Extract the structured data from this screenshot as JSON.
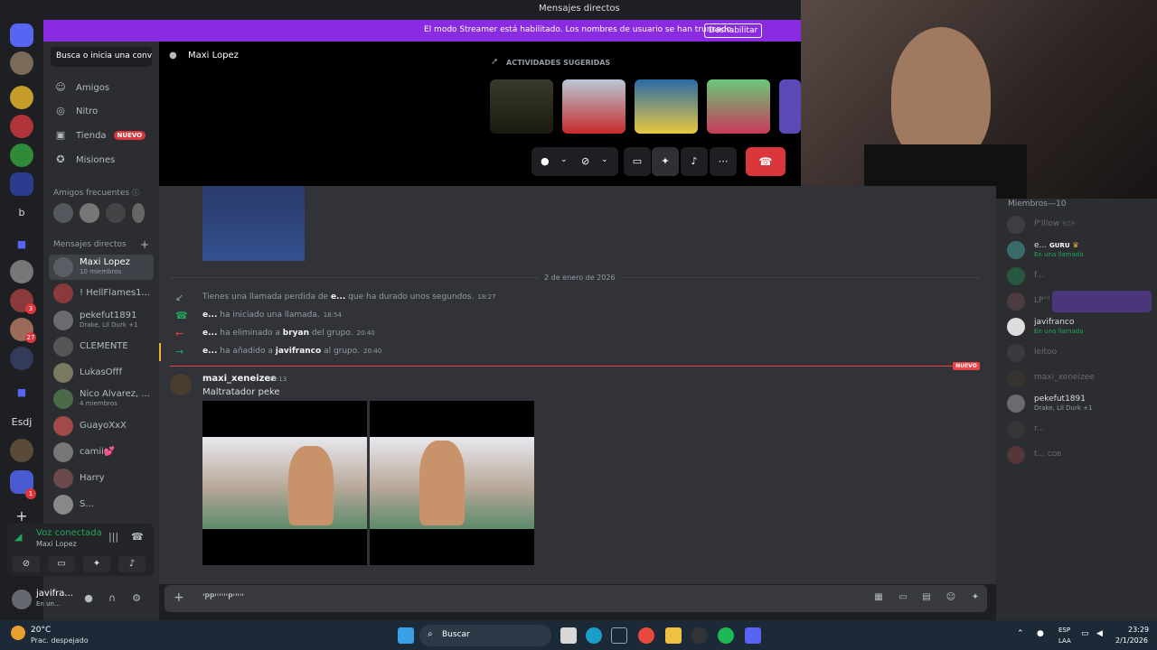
{
  "window": {
    "title": "Mensajes directos"
  },
  "streamer": {
    "message": "El modo Streamer está habilitado. Los nombres de usuario se han truncado.",
    "disable_label": "Deshabilitar"
  },
  "sidebar": {
    "search_label": "Busca o inicia una conv...",
    "nav": [
      {
        "label": "Amigos",
        "icon": "friends-icon"
      },
      {
        "label": "Nitro",
        "icon": "nitro-icon"
      },
      {
        "label": "Tienda",
        "icon": "shop-icon",
        "badge": "NUEVO"
      },
      {
        "label": "Misiones",
        "icon": "quests-icon"
      }
    ],
    "frequent_label": "Amigos frecuentes",
    "dm_label": "Mensajes directos",
    "dms": [
      {
        "name": "Maxi Lopez",
        "sub": "10 miembros"
      },
      {
        "name": "! HellFlames1..."
      },
      {
        "name": "pekefut1891",
        "sub": "Drake, Lil Durk +1"
      },
      {
        "name": "CLEMENTE"
      },
      {
        "name": "LukasOfff"
      },
      {
        "name": "Nico Alvarez, ...",
        "sub": "4 miembros"
      },
      {
        "name": "GuayoXxX"
      },
      {
        "name": "camii💕"
      },
      {
        "name": "Harry"
      },
      {
        "name": "S..."
      }
    ],
    "guild_text": {
      "b": "b",
      "esdj": "Esdj"
    },
    "guild_badges": [
      "3",
      "27",
      "1"
    ]
  },
  "voice": {
    "status": "Voz conectada",
    "channel": "Maxi Lopez"
  },
  "user": {
    "name": "javifra...",
    "status": "En un..."
  },
  "call": {
    "name": "Maxi Lopez",
    "activities_title": "ACTIVIDADES SUGERIDAS"
  },
  "chat": {
    "date": "2 de enero de 2026",
    "system": [
      {
        "pre": "Tienes una llamada perdida de ",
        "bold": "e...",
        "post": " que ha durado unos segundos.",
        "time": "18:27",
        "color": "#949ba4"
      },
      {
        "pre": "",
        "bold": "e...",
        "post": " ha iniciado una llamada.",
        "time": "18:54",
        "color": "#23a55a"
      },
      {
        "pre": "",
        "bold": "e...",
        "mid": " ha eliminado a ",
        "bold2": "bryan",
        "post": " del grupo.",
        "time": "20:40",
        "color": "#f23f43"
      },
      {
        "pre": "",
        "bold": "e...",
        "mid": " ha añadido a ",
        "bold2": "javifranco",
        "post": " al grupo.",
        "time": "20:40",
        "color": "#23a55a"
      }
    ],
    "new_label": "NUEVO",
    "message": {
      "author": "maxi_xeneizee",
      "time": "23:13",
      "text": "Maltratador peke"
    },
    "composer_value": "'PP''''''P'''''"
  },
  "members": {
    "title": "Miembros—10",
    "list": [
      {
        "name": "P'lllow",
        "tag": "RZR",
        "dim": true
      },
      {
        "name": "e...",
        "tag": "GURU",
        "sub": "En una llamada",
        "dim": false
      },
      {
        "name": "f...",
        "dim": true
      },
      {
        "name": "LP'''",
        "dim": true
      },
      {
        "name": "javifranco",
        "sub": "En una llamada",
        "dim": false
      },
      {
        "name": "leitoo",
        "dim": true
      },
      {
        "name": "maxi_xeneizee",
        "dim": true
      },
      {
        "name": "pekefut1891",
        "sub": "Drake, Lil Durk +1",
        "dim": false
      },
      {
        "name": "r...",
        "dim": true
      },
      {
        "name": "t...",
        "tag": "COB",
        "dim": true
      }
    ]
  },
  "taskbar": {
    "weather_temp": "20°C",
    "weather_desc": "Prac. despejado",
    "search": "Buscar",
    "lang1": "ESP",
    "lang2": "LAA",
    "time": "23:29",
    "date": "2/1/2026"
  },
  "colors": {
    "accent": "#5865f2",
    "streamer": "#8a2be2",
    "danger": "#da373c",
    "online": "#23a55a"
  }
}
